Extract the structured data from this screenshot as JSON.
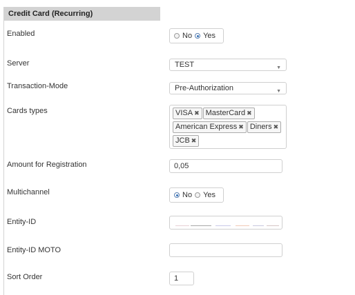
{
  "section": {
    "title": "Credit Card (Recurring)"
  },
  "fields": {
    "enabled": {
      "label": "Enabled",
      "options": [
        "No",
        "Yes"
      ],
      "selected": "Yes"
    },
    "server": {
      "label": "Server",
      "value": "TEST"
    },
    "transaction_mode": {
      "label": "Transaction-Mode",
      "value": "Pre-Authorization"
    },
    "card_types": {
      "label": "Cards types",
      "tags": [
        "VISA",
        "MasterCard",
        "American Express",
        "Diners",
        "JCB"
      ]
    },
    "amount_registration": {
      "label": "Amount for Registration",
      "value": "0,05"
    },
    "multichannel": {
      "label": "Multichannel",
      "options": [
        "No",
        "Yes"
      ],
      "selected": "No"
    },
    "entity_id": {
      "label": "Entity-ID",
      "value": ""
    },
    "entity_id_moto": {
      "label": "Entity-ID MOTO",
      "value": ""
    },
    "sort_order": {
      "label": "Sort Order",
      "value": "1"
    }
  },
  "icons": {
    "remove": "close-icon",
    "dropdown": "chevron-down-icon"
  },
  "colors": {
    "header_bg": "#d3d3d3",
    "radio_checked": "#2f6db5",
    "border": "#cfcfcf"
  }
}
